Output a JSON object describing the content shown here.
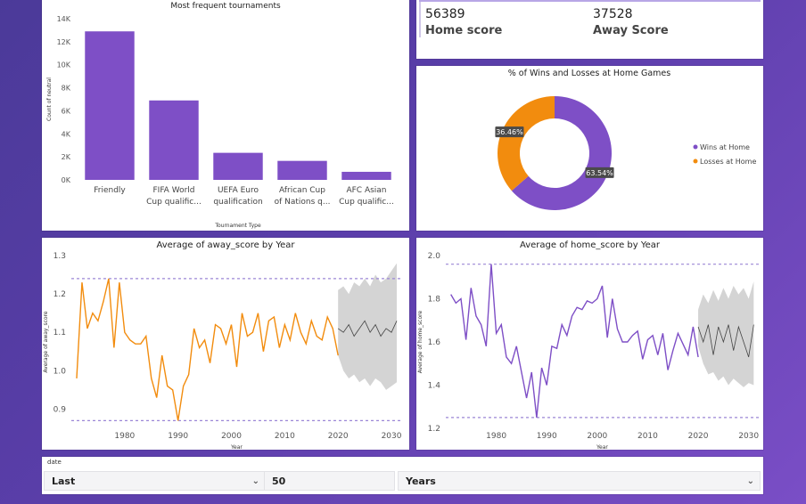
{
  "kpis": {
    "home_value": "56389",
    "home_label": "Home score",
    "away_value": "37528",
    "away_label": "Away Score"
  },
  "slicer": {
    "label": "date",
    "mode": "Last",
    "amount": "50",
    "unit": "Years"
  },
  "colors": {
    "purple": "#7e4fc6",
    "orange": "#f28c0e",
    "forecast_band": "#cfcfcf",
    "ref_line": "#9b86d6"
  },
  "icons": [
    "chevron-down-icon"
  ],
  "chart_data": [
    {
      "id": "tournaments",
      "type": "bar",
      "title": "Most frequent tournaments",
      "xlabel": "Tournament Type",
      "ylabel": "Count of neutral",
      "ylim": [
        0,
        14000
      ],
      "yticks": [
        "0K",
        "2K",
        "4K",
        "6K",
        "8K",
        "10K",
        "12K",
        "14K"
      ],
      "categories": [
        [
          "Friendly"
        ],
        [
          "FIFA World",
          "Cup qualific..."
        ],
        [
          "UEFA Euro",
          "qualification"
        ],
        [
          "African Cup",
          "of Nations q..."
        ],
        [
          "AFC Asian",
          "Cup qualific..."
        ]
      ],
      "values": [
        12900,
        6900,
        2350,
        1650,
        700
      ]
    },
    {
      "id": "winloss",
      "type": "pie",
      "title": "% of Wins and Losses at Home Games",
      "labels": [
        "Wins at Home",
        "Losses at Home"
      ],
      "values": [
        63.54,
        36.46
      ],
      "value_labels": [
        "63.54%",
        "36.46%"
      ],
      "legend": "right"
    },
    {
      "id": "away",
      "type": "line",
      "title": "Average of away_score by Year",
      "xlabel": "Year",
      "ylabel": "Average of away_score",
      "xlim": [
        1970,
        2032
      ],
      "ylim": [
        0.85,
        1.3
      ],
      "yticks": [
        0.9,
        1.0,
        1.1,
        1.2,
        1.3
      ],
      "ytick_labels": [
        "0.9",
        "1.0",
        "1.1",
        "1.2",
        "1.3"
      ],
      "xticks": [
        1980,
        1990,
        2000,
        2010,
        2020,
        2030
      ],
      "ref_lines": [
        1.24,
        0.87
      ],
      "x": [
        1971,
        1972,
        1973,
        1974,
        1975,
        1976,
        1977,
        1978,
        1979,
        1980,
        1981,
        1982,
        1983,
        1984,
        1985,
        1986,
        1987,
        1988,
        1989,
        1990,
        1991,
        1992,
        1993,
        1994,
        1995,
        1996,
        1997,
        1998,
        1999,
        2000,
        2001,
        2002,
        2003,
        2004,
        2005,
        2006,
        2007,
        2008,
        2009,
        2010,
        2011,
        2012,
        2013,
        2014,
        2015,
        2016,
        2017,
        2018,
        2019,
        2020
      ],
      "y": [
        0.98,
        1.23,
        1.11,
        1.15,
        1.13,
        1.18,
        1.24,
        1.06,
        1.23,
        1.1,
        1.08,
        1.07,
        1.07,
        1.09,
        0.98,
        0.93,
        1.04,
        0.96,
        0.95,
        0.87,
        0.96,
        0.99,
        1.11,
        1.06,
        1.08,
        1.02,
        1.12,
        1.11,
        1.07,
        1.12,
        1.01,
        1.15,
        1.09,
        1.1,
        1.15,
        1.05,
        1.13,
        1.14,
        1.06,
        1.12,
        1.08,
        1.15,
        1.1,
        1.07,
        1.13,
        1.09,
        1.08,
        1.14,
        1.11,
        1.04
      ],
      "forecast": {
        "x": [
          2020,
          2021,
          2022,
          2023,
          2024,
          2025,
          2026,
          2027,
          2028,
          2029,
          2030,
          2031
        ],
        "y": [
          1.11,
          1.1,
          1.12,
          1.09,
          1.11,
          1.13,
          1.1,
          1.12,
          1.09,
          1.11,
          1.1,
          1.13
        ],
        "lower": [
          1.04,
          1.0,
          0.98,
          0.99,
          0.97,
          0.98,
          0.96,
          0.98,
          0.97,
          0.95,
          0.96,
          0.97
        ],
        "upper": [
          1.21,
          1.22,
          1.2,
          1.23,
          1.22,
          1.24,
          1.22,
          1.25,
          1.23,
          1.24,
          1.26,
          1.28
        ]
      }
    },
    {
      "id": "home",
      "type": "line",
      "title": "Average of home_score by Year",
      "xlabel": "Year",
      "ylabel": "Average of home_score",
      "xlim": [
        1970,
        2032
      ],
      "ylim": [
        1.2,
        2.0
      ],
      "yticks": [
        1.2,
        1.4,
        1.6,
        1.8,
        2.0
      ],
      "ytick_labels": [
        "1.2",
        "1.4",
        "1.6",
        "1.8",
        "2.0"
      ],
      "xticks": [
        1980,
        1990,
        2000,
        2010,
        2020,
        2030
      ],
      "ref_lines": [
        1.96,
        1.25
      ],
      "x": [
        1971,
        1972,
        1973,
        1974,
        1975,
        1976,
        1977,
        1978,
        1979,
        1980,
        1981,
        1982,
        1983,
        1984,
        1985,
        1986,
        1987,
        1988,
        1989,
        1990,
        1991,
        1992,
        1993,
        1994,
        1995,
        1996,
        1997,
        1998,
        1999,
        2000,
        2001,
        2002,
        2003,
        2004,
        2005,
        2006,
        2007,
        2008,
        2009,
        2010,
        2011,
        2012,
        2013,
        2014,
        2015,
        2016,
        2017,
        2018,
        2019,
        2020
      ],
      "y": [
        1.82,
        1.78,
        1.8,
        1.61,
        1.85,
        1.72,
        1.68,
        1.58,
        1.96,
        1.64,
        1.68,
        1.53,
        1.5,
        1.58,
        1.46,
        1.34,
        1.46,
        1.25,
        1.48,
        1.4,
        1.58,
        1.57,
        1.68,
        1.63,
        1.72,
        1.76,
        1.75,
        1.79,
        1.78,
        1.8,
        1.86,
        1.62,
        1.8,
        1.66,
        1.6,
        1.6,
        1.63,
        1.65,
        1.52,
        1.61,
        1.63,
        1.54,
        1.64,
        1.47,
        1.56,
        1.64,
        1.59,
        1.54,
        1.67,
        1.53
      ],
      "forecast": {
        "x": [
          2020,
          2021,
          2022,
          2023,
          2024,
          2025,
          2026,
          2027,
          2028,
          2029,
          2030,
          2031
        ],
        "y": [
          1.67,
          1.6,
          1.68,
          1.54,
          1.67,
          1.6,
          1.68,
          1.56,
          1.67,
          1.6,
          1.53,
          1.68
        ],
        "lower": [
          1.58,
          1.5,
          1.45,
          1.46,
          1.42,
          1.44,
          1.4,
          1.43,
          1.41,
          1.39,
          1.41,
          1.4
        ],
        "upper": [
          1.75,
          1.82,
          1.78,
          1.84,
          1.79,
          1.85,
          1.8,
          1.86,
          1.82,
          1.85,
          1.8,
          1.88
        ]
      }
    }
  ]
}
